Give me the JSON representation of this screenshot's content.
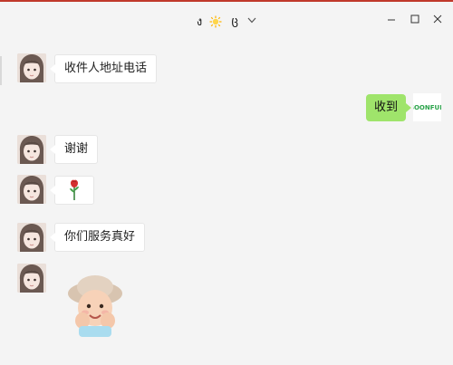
{
  "window": {
    "title": {
      "prefix": "ง",
      "suffix": "ც",
      "emoji_icon": "sun-emoji-icon"
    },
    "controls": {
      "minimize_icon": "minimize-icon",
      "maximize_icon": "maximize-icon",
      "close_icon": "close-icon"
    }
  },
  "messages": [
    {
      "side": "left",
      "type": "text",
      "text": "收件人地址电话"
    },
    {
      "side": "right",
      "type": "text",
      "text": "收到"
    },
    {
      "side": "left",
      "type": "text",
      "text": "谢谢"
    },
    {
      "side": "left",
      "type": "emoji",
      "icon": "rose-icon"
    },
    {
      "side": "left",
      "type": "text",
      "text": "你们服务真好"
    },
    {
      "side": "left",
      "type": "sticker",
      "icon": "smiling-baby-sticker-icon"
    }
  ],
  "my_avatar": {
    "logo_text": "SOONFUN"
  },
  "colors": {
    "background": "#f4f4f4",
    "incoming_bubble": "#ffffff",
    "outgoing_bubble": "#9fe46b",
    "top_accent": "#c0392b",
    "logo": "#2aa34a"
  }
}
